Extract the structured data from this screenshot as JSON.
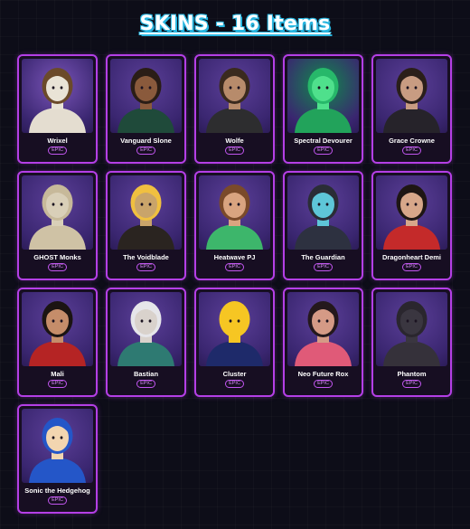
{
  "header": {
    "title": "SKINS - 16 Items"
  },
  "colors": {
    "accent": "#b43fe6",
    "background": "#0d0d18",
    "title_shadow": "#28b6e0"
  },
  "items": [
    {
      "name": "Wrixel",
      "rarity": "EPIC",
      "icon": "block-head-skin-icon",
      "bg": "#7a55b8",
      "skin": "#e9e3d6",
      "hair": "#6b4a2a",
      "body": "#e4ddd0"
    },
    {
      "name": "Vanguard Slone",
      "rarity": "EPIC",
      "icon": "curly-hair-armored-skin-icon",
      "bg": "#5b3f98",
      "skin": "#8a5a3c",
      "hair": "#2a1d16",
      "body": "#1f4a3a"
    },
    {
      "name": "Wolfe",
      "rarity": "EPIC",
      "icon": "bearded-soldier-skin-icon",
      "bg": "#5b3f98",
      "skin": "#b78b6b",
      "hair": "#3a2a1e",
      "body": "#2d2d2f"
    },
    {
      "name": "Spectral Devourer",
      "rarity": "EPIC",
      "icon": "green-skull-monster-skin-icon",
      "bg": "#118a4c",
      "skin": "#4fe08c",
      "hair": "#27b86a",
      "body": "#22a35b"
    },
    {
      "name": "Grace Crowne",
      "rarity": "EPIC",
      "icon": "leather-suit-skin-icon",
      "bg": "#5b3f98",
      "skin": "#c89c82",
      "hair": "#2a1f1a",
      "body": "#26232a"
    },
    {
      "name": "GHOST Monks",
      "rarity": "EPIC",
      "icon": "monkey-skin-icon",
      "bg": "#5b3f98",
      "skin": "#d9cfb8",
      "hair": "#c7b99a",
      "body": "#cfc2a5"
    },
    {
      "name": "The Voidblade",
      "rarity": "EPIC",
      "icon": "masked-ninja-skin-icon",
      "bg": "#5b3f98",
      "skin": "#c9a46a",
      "hair": "#f0c040",
      "body": "#2a2420"
    },
    {
      "name": "Heatwave PJ",
      "rarity": "EPIC",
      "icon": "beach-girl-skin-icon",
      "bg": "#5b3f98",
      "skin": "#d9a480",
      "hair": "#7a4a2a",
      "body": "#3db66b"
    },
    {
      "name": "The Guardian",
      "rarity": "EPIC",
      "icon": "robot-guardian-skin-icon",
      "bg": "#5b3f98",
      "skin": "#5ec6d8",
      "hair": "#2a2d36",
      "body": "#2d3140"
    },
    {
      "name": "Dragonheart Demi",
      "rarity": "EPIC",
      "icon": "red-dress-skin-icon",
      "bg": "#5b3f98",
      "skin": "#d7a78a",
      "hair": "#1e1614",
      "body": "#c42a2a"
    },
    {
      "name": "Mali",
      "rarity": "EPIC",
      "icon": "fighter-girl-skin-icon",
      "bg": "#5b3f98",
      "skin": "#c58d6a",
      "hair": "#1b1412",
      "body": "#b52424"
    },
    {
      "name": "Bastian",
      "rarity": "EPIC",
      "icon": "hooded-teal-skin-icon",
      "bg": "#5b3f98",
      "skin": "#d9d2cc",
      "hair": "#e6e6ea",
      "body": "#2e7a72"
    },
    {
      "name": "Cluster",
      "rarity": "EPIC",
      "icon": "duck-sunglasses-skin-icon",
      "bg": "#5b3f98",
      "skin": "#f6c623",
      "hair": "#f6c623",
      "body": "#1e2a6a"
    },
    {
      "name": "Neo Future Rox",
      "rarity": "EPIC",
      "icon": "visor-girl-skin-icon",
      "bg": "#5b3f98",
      "skin": "#d59a86",
      "hair": "#24181c",
      "body": "#e05a78"
    },
    {
      "name": "Phantom",
      "rarity": "EPIC",
      "icon": "dark-armor-skin-icon",
      "bg": "#5b3f98",
      "skin": "#3a3640",
      "hair": "#2a262e",
      "body": "#35313a"
    },
    {
      "name": "Sonic the Hedgehog",
      "rarity": "EPIC",
      "icon": "blue-hedgehog-skin-icon",
      "bg": "#5b3f98",
      "skin": "#f2d5b0",
      "hair": "#2456c8",
      "body": "#2456c8"
    }
  ]
}
